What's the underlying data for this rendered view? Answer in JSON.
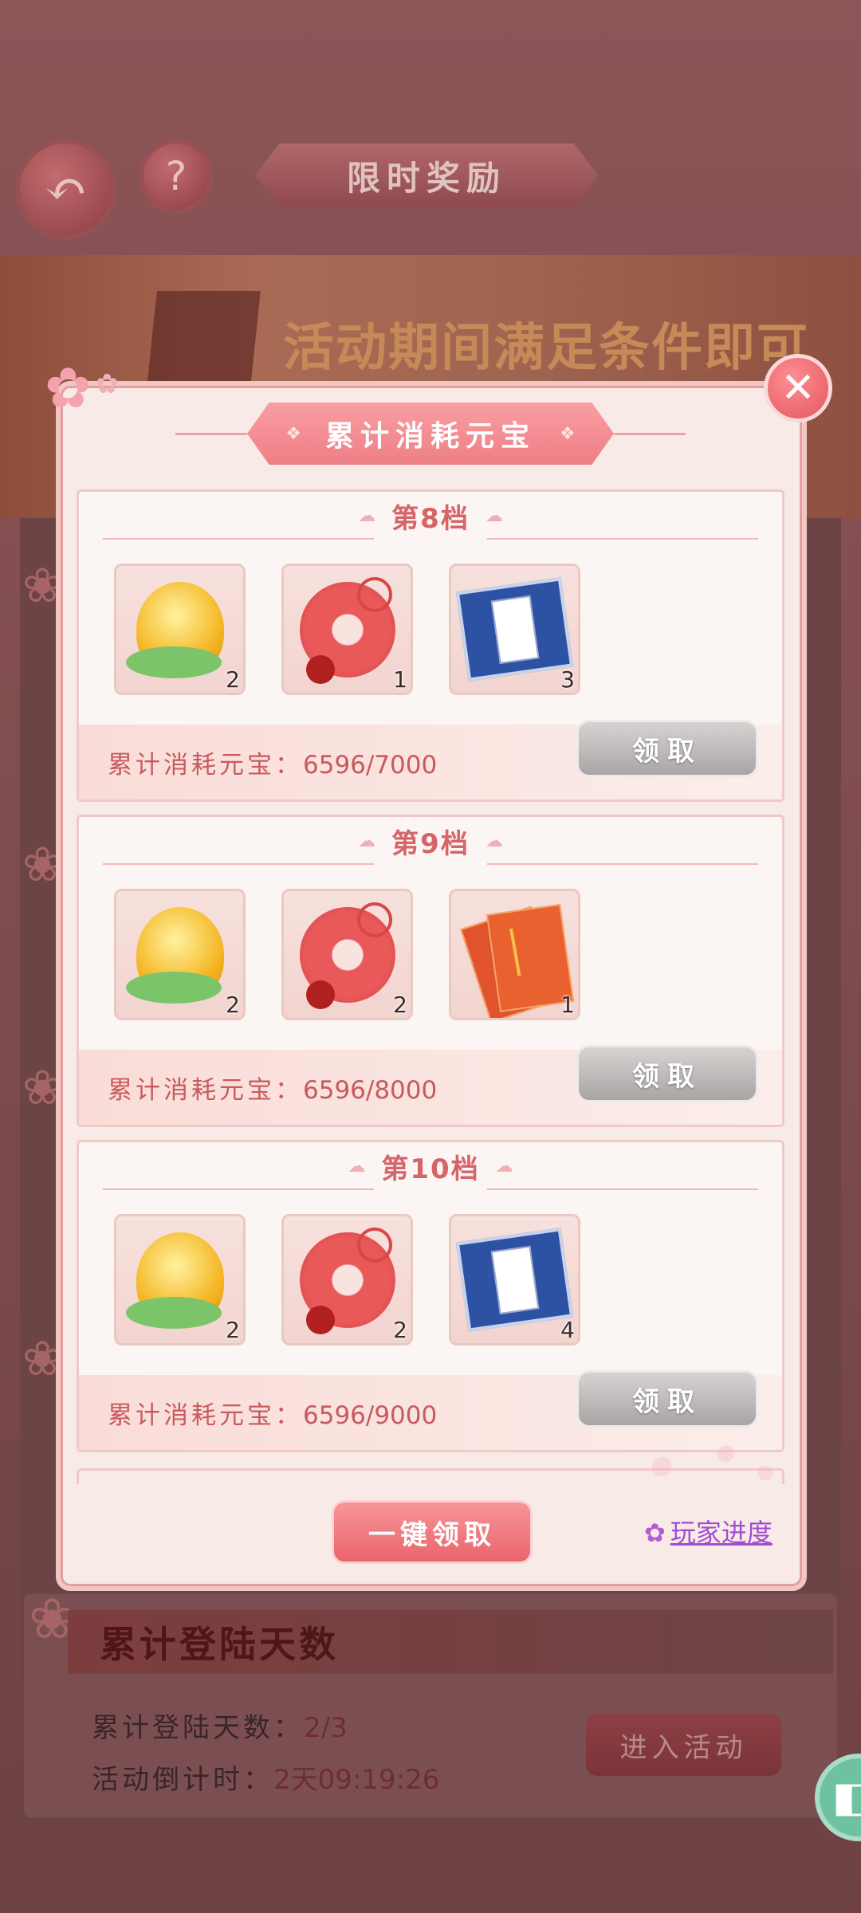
{
  "background": {
    "title": "限时奖励",
    "help_label": "?",
    "banner_text": "活动期间满足条件即可",
    "login_card": {
      "header": "累计登陆天数",
      "days_label": "累计登陆天数：",
      "days_value": "2/3",
      "countdown_label": "活动倒计时：",
      "countdown_value": "2天09:19:26",
      "enter_button": "进入活动"
    }
  },
  "modal": {
    "title": "累计消耗元宝",
    "tiers": [
      {
        "title_prefix": "第",
        "number": "8",
        "title_suffix": "档",
        "items": [
          {
            "icon": "gold-mask-icon",
            "count": "2"
          },
          {
            "icon": "red-jade-pendant-icon",
            "count": "1"
          },
          {
            "icon": "blue-book-icon",
            "count": "3"
          }
        ],
        "progress_label": "累计消耗元宝：",
        "progress_value": "6596/7000",
        "claim_label": "领取"
      },
      {
        "title_prefix": "第",
        "number": "9",
        "title_suffix": "档",
        "items": [
          {
            "icon": "gold-mask-icon",
            "count": "2"
          },
          {
            "icon": "red-jade-pendant-icon",
            "count": "2"
          },
          {
            "icon": "red-envelope-icon",
            "count": "1"
          }
        ],
        "progress_label": "累计消耗元宝：",
        "progress_value": "6596/8000",
        "claim_label": "领取"
      },
      {
        "title_prefix": "第",
        "number": "10",
        "title_suffix": "档",
        "items": [
          {
            "icon": "gold-mask-icon",
            "count": "2"
          },
          {
            "icon": "red-jade-pendant-icon",
            "count": "2"
          },
          {
            "icon": "blue-book-icon",
            "count": "4"
          }
        ],
        "progress_label": "累计消耗元宝：",
        "progress_value": "6596/9000",
        "claim_label": "领取"
      }
    ],
    "claim_all_label": "一键领取",
    "player_progress_label": "玩家进度"
  },
  "colors": {
    "accent_pink": "#ee7f86",
    "progress_text": "#c85a5d",
    "disabled_button": "#a9a5a4",
    "link_purple": "#a14bd4"
  }
}
